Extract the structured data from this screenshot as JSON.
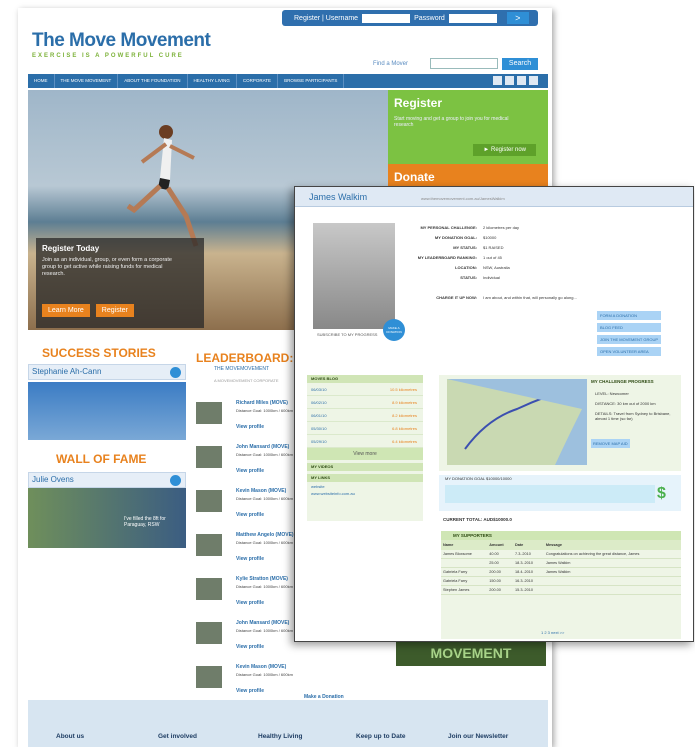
{
  "header": {
    "register_link": "Register | Username",
    "password_label": "Password",
    "go": ">",
    "logo": "The Move Movement",
    "tagline": "EXERCISE IS A POWERFUL CURE",
    "find_label": "Find a Mover",
    "search_button": "Search"
  },
  "nav": [
    "HOME",
    "THE MOVE MOVEMENT",
    "ABOUT THE FOUNDATION",
    "HEALTHY LIVING",
    "CORPORATE",
    "BROWSE PARTICIPANTS"
  ],
  "hero": {
    "register_title": "Register Today",
    "register_text": "Join as an individual, group, or even form a corporate group to get active while raising funds for medical research.",
    "learn_more": "Learn More",
    "register_button": "Register"
  },
  "side_register": {
    "title": "Register",
    "text": "Start moving and get a group to join you for medical research",
    "button": "► Register now"
  },
  "donate": {
    "title": "Donate"
  },
  "success_stories": {
    "title": "SUCCESS STORIES",
    "name": "Stephanie Ah-Cann"
  },
  "wall_of_fame": {
    "title": "WALL OF FAME",
    "name": "Julie Ovens",
    "caption": "I've filled the 8ft for Paraguay, RSW"
  },
  "leaderboard": {
    "title": "LEADERBOARD:",
    "subtitle": "THE MOVEMOVEMENT",
    "tabs": "A MOVEMOVEMENT  CORPORATE",
    "rows": [
      {
        "name": "Richard Miles (MOVE)",
        "detail": "Distance Goal: 1000km / 600km",
        "view": "View profile"
      },
      {
        "name": "John Mansard (MOVE)",
        "detail": "Distance Goal: 1000km / 600km",
        "view": "View profile"
      },
      {
        "name": "Kevin Mason (MOVE)",
        "detail": "Distance Goal: 1000km / 600km",
        "view": "View profile"
      },
      {
        "name": "Matthew Angelo (MOVE)",
        "detail": "Distance Goal: 1000km / 600km",
        "view": "View profile"
      },
      {
        "name": "Kylie Stratton (MOVE)",
        "detail": "Distance Goal: 1000km / 600km",
        "view": "View profile"
      },
      {
        "name": "John Mansard (MOVE)",
        "detail": "Distance Goal: 1000km / 600km",
        "view": "View profile"
      },
      {
        "name": "Kevin Mason (MOVE)",
        "detail": "Distance Goal: 1000km / 600km",
        "view": "View profile"
      }
    ],
    "make_donation": "Make a Donation"
  },
  "green_banner": "MOVEMENT",
  "footer": [
    "About us",
    "Get involved",
    "Healthy Living",
    "Keep up to Date",
    "Join our Newsletter"
  ],
  "profile": {
    "name": "James Walkim",
    "url": "www.themovemovement.com.au/JamesWalkim",
    "photo_caption": "SUBSCRIBE TO MY PROGRESS",
    "fields": [
      {
        "label": "MY PERSONAL CHALLENGE:",
        "value": "2 kilometres per day"
      },
      {
        "label": "MY DONATION GOAL:",
        "value": "$10000"
      },
      {
        "label": "MY STATUS:",
        "value": "$1 RAISED"
      },
      {
        "label": "MY LEADERBOARD RANKING:",
        "value": "1 out of 45"
      },
      {
        "label": "LOCATION:",
        "value": "NSW, Australia"
      },
      {
        "label": "STATUS:",
        "value": "Individual"
      },
      {
        "label": "CHARGE IT UP NOW:",
        "value": "I am about, and within that, will personally go along..."
      }
    ],
    "side_buttons": [
      "FORM A DONATION",
      "BLOG FEED",
      "JOIN THE MOVEMENT GROUP",
      "OPEN VOLUNTEER AREA"
    ],
    "badge_text": "MAKE A DONATION",
    "journal": {
      "title": "MOVES BLOG",
      "rows": [
        {
          "date": "06/03/10",
          "km": "10.5 kilometres"
        },
        {
          "date": "06/02/10",
          "km": "8.9 kilometres"
        },
        {
          "date": "06/01/10",
          "km": "8.2 kilometres"
        },
        {
          "date": "05/30/10",
          "km": "6.8 kilometres"
        },
        {
          "date": "05/29/10",
          "km": "6.4 kilometres"
        }
      ],
      "view_more": "View more",
      "my_videos": "MY VIDEOS",
      "my_links": "MY LINKS",
      "links": [
        "website",
        "www.websiteinfo.com.au"
      ]
    },
    "progress": {
      "title": "MY CHALLENGE PROGRESS",
      "rows": [
        "LEVEL: Newcomer",
        "DISTANCE: 30 km out of 2000 km",
        "DETAILS: Travel from Sydney to Brisbane, almost 1 time (so far)"
      ],
      "map_button": "REMOVE MAP AID"
    },
    "donation_header": "MY DONATION GOAL    $10000/10000",
    "currency": "$",
    "current_total": "CURRENT TOTAL:     AUD$10000.0",
    "supporters": {
      "title": "MY SUPPORTERS",
      "headers": [
        "Name",
        "Amount",
        "Date",
        "Message"
      ],
      "rows": [
        [
          "James Bloxsome",
          "40.00",
          "7.3..2010",
          "Congratulations on achieving the great distance, James"
        ],
        [
          "",
          "25.00",
          "18.3..2010",
          "James Walkim"
        ],
        [
          "Gabriela Farry",
          "200.00",
          "18.4..2010",
          "James Walkim"
        ],
        [
          "Gabriela Farry",
          "150.00",
          "16.3..2010",
          ""
        ],
        [
          "Stephen James",
          "200.00",
          "15.3..2010",
          ""
        ]
      ],
      "see_all": "1 2 3  next >>"
    }
  }
}
